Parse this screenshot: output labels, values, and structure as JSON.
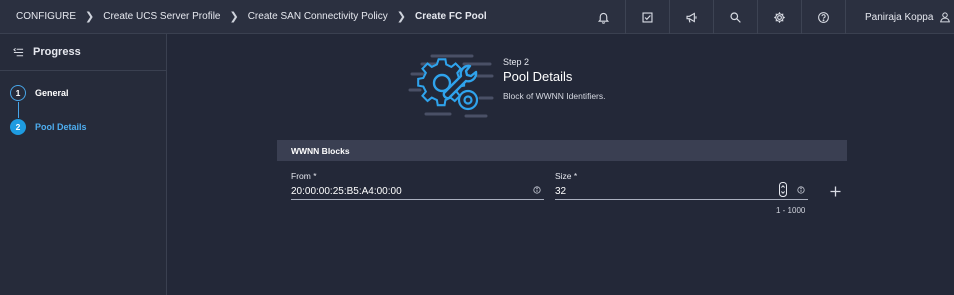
{
  "breadcrumb": {
    "items": [
      "CONFIGURE",
      "Create UCS Server Profile",
      "Create SAN Connectivity Policy",
      "Create FC Pool"
    ]
  },
  "header": {
    "icons": [
      "bell-icon",
      "checklist-icon",
      "megaphone-icon",
      "search-icon",
      "gear-icon",
      "help-icon"
    ],
    "user_name": "Paniraja Koppa"
  },
  "sidebar": {
    "title": "Progress",
    "steps": [
      {
        "number": "1",
        "label": "General"
      },
      {
        "number": "2",
        "label": "Pool Details"
      }
    ]
  },
  "main": {
    "step_label": "Step 2",
    "title": "Pool Details",
    "description": "Block of WWNN Identifiers.",
    "section_title": "WWNN Blocks",
    "from_label": "From *",
    "from_value": "20:00:00:25:B5:A4:00:00",
    "size_label": "Size *",
    "size_value": "32",
    "size_hint": "1 - 1000"
  },
  "colors": {
    "accent": "#1e9be0",
    "background": "#232838",
    "topbar": "#2b3040",
    "section_header": "#3a3f52"
  }
}
